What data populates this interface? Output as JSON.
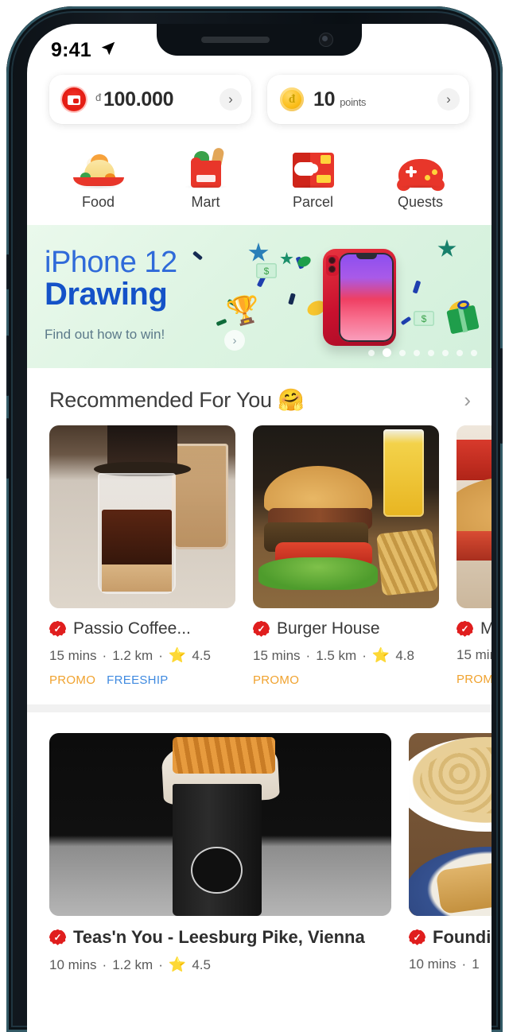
{
  "status_bar": {
    "time": "9:41",
    "location_icon": "location-arrow-icon"
  },
  "balances": [
    {
      "icon": "wallet-icon",
      "currency_symbol": "đ",
      "amount": "100.000",
      "unit": "",
      "chevron": "›"
    },
    {
      "icon": "coin-icon",
      "currency_symbol": "",
      "amount": "10",
      "unit": "points",
      "chevron": "›"
    }
  ],
  "categories": [
    {
      "label": "Food",
      "icon": "noodle-bowl-icon"
    },
    {
      "label": "Mart",
      "icon": "grocery-bag-icon"
    },
    {
      "label": "Parcel",
      "icon": "parcel-box-icon"
    },
    {
      "label": "Quests",
      "icon": "game-controller-icon"
    }
  ],
  "banner": {
    "line1": "iPhone 12",
    "line2": "Drawing",
    "line3": "Find out how to win!",
    "cta_icon": "chevron-right-icon",
    "dots_total": 8,
    "dots_active_index": 1,
    "colors": {
      "bg_from": "#eaf9ec",
      "bg_to": "#d3f0dc",
      "line1": "#2f6ad9",
      "line2": "#1452c8",
      "line3": "#5c7a8a"
    }
  },
  "recommended": {
    "title": "Recommended For You 🤗",
    "chevron": "›",
    "cards": [
      {
        "name": "Passio Coffee...",
        "verified": true,
        "time": "15 mins",
        "distance": "1.2 km",
        "rating": "4.5",
        "tags": [
          "PROMO",
          "FREESHIP"
        ],
        "image": "vietnamese-coffee-photo"
      },
      {
        "name": "Burger House",
        "verified": true,
        "time": "15 mins",
        "distance": "1.5 km",
        "rating": "4.8",
        "tags": [
          "PROMO"
        ],
        "image": "burger-photo"
      },
      {
        "name": "M",
        "verified": true,
        "time": "15 min",
        "distance": "",
        "rating": "",
        "tags": [
          "PROMO"
        ],
        "image": "burger-photo-2"
      }
    ]
  },
  "nearby": {
    "cards": [
      {
        "name": "Teas'n You - Leesburg Pike, Vienna",
        "verified": true,
        "time": "10 mins",
        "distance": "1.2 km",
        "rating": "4.5",
        "image": "black-cup-fries-photo"
      },
      {
        "name": "Founding",
        "verified": true,
        "time": "10 mins",
        "distance": "1",
        "rating": "",
        "image": "pasta-bread-photo"
      }
    ]
  },
  "separators": {
    "dot": "·",
    "star": "★"
  }
}
